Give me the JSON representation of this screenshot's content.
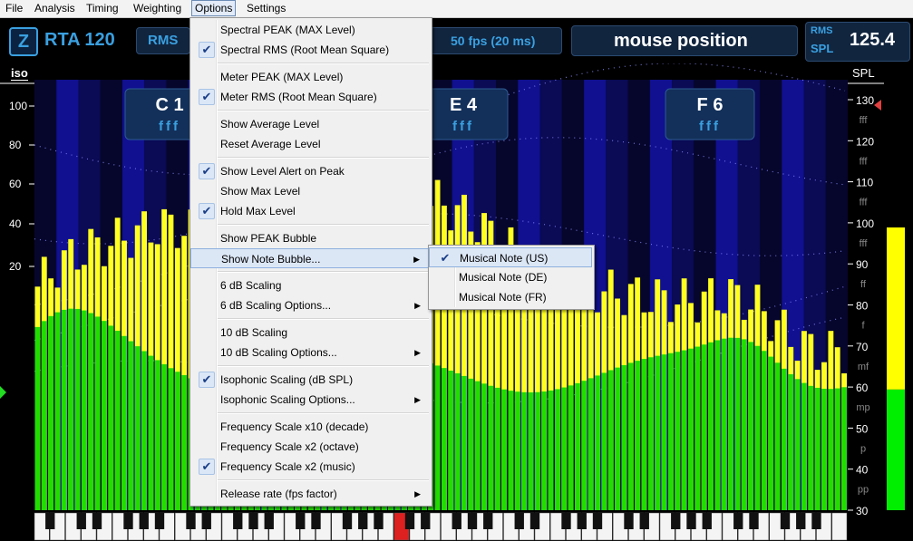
{
  "menubar": {
    "items": [
      "File",
      "Analysis",
      "Timing",
      "Weighting",
      "Options",
      "Settings"
    ],
    "active": "Options"
  },
  "topbar": {
    "app_letter": "Z",
    "title": "RTA 120",
    "mode": "RMS",
    "fps": "50 fps (20 ms)",
    "status": "mouse position",
    "meter_top": "RMS",
    "meter_bottom": "SPL",
    "meter_value": "125.4"
  },
  "axes": {
    "left_label": "iso",
    "right_label": "SPL",
    "left_ticks": [
      "100",
      "80",
      "60",
      "40",
      "20"
    ],
    "right_ticks": [
      "130",
      "120",
      "110",
      "100",
      "90",
      "80",
      "70",
      "60",
      "50",
      "40",
      "30"
    ],
    "dynamics": [
      "fff",
      "fff",
      "fff",
      "fff",
      "ff",
      "f",
      "mf",
      "mp",
      "p",
      "pp"
    ]
  },
  "note_bubbles": [
    {
      "note": "C 1",
      "dyn": "fff"
    },
    {
      "note": "E 4",
      "dyn": "fff"
    },
    {
      "note": "F 6",
      "dyn": "fff"
    }
  ],
  "meter": {
    "level_fraction": 0.75,
    "green_fraction": 0.32,
    "colors": {
      "yellow": "#ffff00",
      "green": "#00ee00"
    }
  },
  "colors": {
    "bar_green": "#22dd00",
    "bar_yellow": "#ffff22",
    "bg_dark": "#0a0a4a",
    "bg_blue": "#1a1ab8",
    "accent": "#3aa0e0"
  },
  "options_menu": {
    "groups": [
      [
        {
          "label": "Spectral PEAK (MAX Level)",
          "checked": false,
          "sub": false
        },
        {
          "label": "Spectral RMS (Root Mean Square)",
          "checked": true,
          "sub": false
        }
      ],
      [
        {
          "label": "Meter PEAK (MAX Level)",
          "checked": false,
          "sub": false
        },
        {
          "label": "Meter RMS (Root Mean Square)",
          "checked": true,
          "sub": false
        }
      ],
      [
        {
          "label": "Show Average Level",
          "checked": false,
          "sub": false
        },
        {
          "label": "Reset Average Level",
          "checked": false,
          "sub": false
        }
      ],
      [
        {
          "label": "Show Level Alert on Peak",
          "checked": true,
          "sub": false
        },
        {
          "label": "Show Max Level",
          "checked": false,
          "sub": false
        },
        {
          "label": "Hold Max Level",
          "checked": true,
          "sub": false
        }
      ],
      [
        {
          "label": "Show PEAK Bubble",
          "checked": false,
          "sub": false
        },
        {
          "label": "Show Note Bubble...",
          "checked": false,
          "sub": true,
          "highlighted": true
        }
      ],
      [
        {
          "label": "6 dB Scaling",
          "checked": false,
          "sub": false
        },
        {
          "label": "6 dB Scaling Options...",
          "checked": false,
          "sub": true
        }
      ],
      [
        {
          "label": "10 dB Scaling",
          "checked": false,
          "sub": false
        },
        {
          "label": "10 dB Scaling Options...",
          "checked": false,
          "sub": true
        }
      ],
      [
        {
          "label": "Isophonic Scaling (dB SPL)",
          "checked": true,
          "sub": false
        },
        {
          "label": "Isophonic Scaling Options...",
          "checked": false,
          "sub": true
        }
      ],
      [
        {
          "label": "Frequency Scale x10 (decade)",
          "checked": false,
          "sub": false
        },
        {
          "label": "Frequency Scale x2 (octave)",
          "checked": false,
          "sub": false
        },
        {
          "label": "Frequency Scale x2 (music)",
          "checked": true,
          "sub": false
        }
      ],
      [
        {
          "label": "Release rate (fps factor)",
          "checked": false,
          "sub": true
        }
      ]
    ]
  },
  "note_submenu": {
    "items": [
      {
        "label": "Musical Note (US)",
        "checked": true
      },
      {
        "label": "Musical Note (DE)",
        "checked": false
      },
      {
        "label": "Musical Note (FR)",
        "checked": false
      }
    ]
  }
}
